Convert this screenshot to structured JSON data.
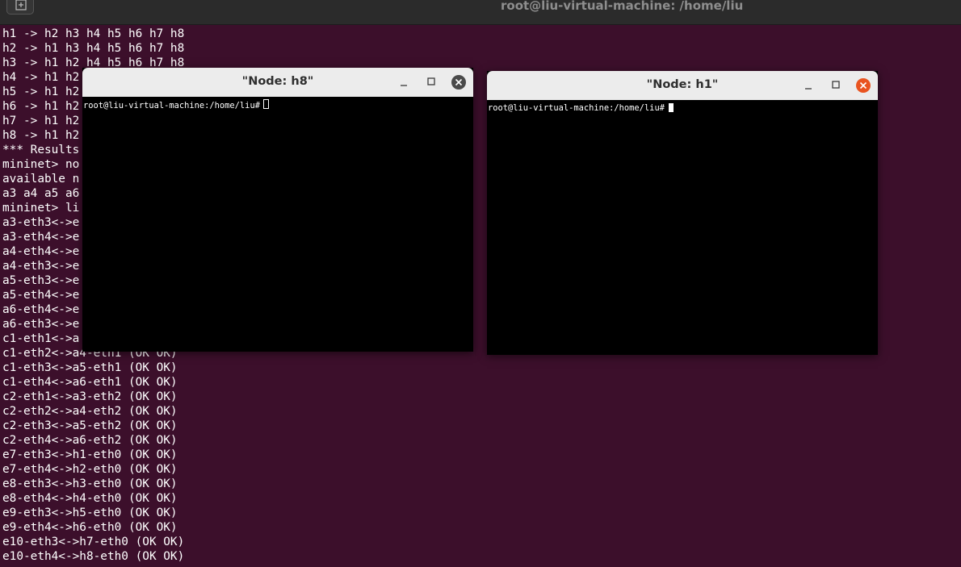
{
  "window": {
    "title": "root@liu-virtual-machine: /home/liu",
    "new_tab_icon": "new-tab-icon"
  },
  "terminal": {
    "lines": [
      "h1 -> h2 h3 h4 h5 h6 h7 h8",
      "h2 -> h1 h3 h4 h5 h6 h7 h8",
      "h3 -> h1 h2 h4 h5 h6 h7 h8",
      "h4 -> h1 h2",
      "h5 -> h1 h2",
      "h6 -> h1 h2",
      "h7 -> h1 h2",
      "h8 -> h1 h2",
      "*** Results",
      "mininet> no",
      "available n",
      "a3 a4 a5 a6",
      "mininet> li",
      "a3-eth3<->e",
      "a3-eth4<->e",
      "a4-eth4<->e",
      "a4-eth3<->e",
      "a5-eth3<->e",
      "a5-eth4<->e",
      "a6-eth4<->e",
      "a6-eth3<->e",
      "c1-eth1<->a",
      "c1-eth2<->a4-eth1 (OK OK)",
      "c1-eth3<->a5-eth1 (OK OK)",
      "c1-eth4<->a6-eth1 (OK OK)",
      "c2-eth1<->a3-eth2 (OK OK)",
      "c2-eth2<->a4-eth2 (OK OK)",
      "c2-eth3<->a5-eth2 (OK OK)",
      "c2-eth4<->a6-eth2 (OK OK)",
      "e7-eth3<->h1-eth0 (OK OK)",
      "e7-eth4<->h2-eth0 (OK OK)",
      "e8-eth3<->h3-eth0 (OK OK)",
      "e8-eth4<->h4-eth0 (OK OK)",
      "e9-eth3<->h5-eth0 (OK OK)",
      "e9-eth4<->h6-eth0 (OK OK)",
      "e10-eth3<->h7-eth0 (OK OK)",
      "e10-eth4<->h8-eth0 (OK OK)"
    ]
  },
  "node_h8": {
    "title": "\"Node: h8\"",
    "prompt": "root@liu-virtual-machine:/home/liu#",
    "close_color": "#4a4a4a"
  },
  "node_h1": {
    "title": "\"Node: h1\"",
    "prompt": "root@liu-virtual-machine:/home/liu#",
    "close_color": "#e95420"
  },
  "colors": {
    "terminal_bg": "#3c0f2b",
    "accent": "#e95420"
  }
}
